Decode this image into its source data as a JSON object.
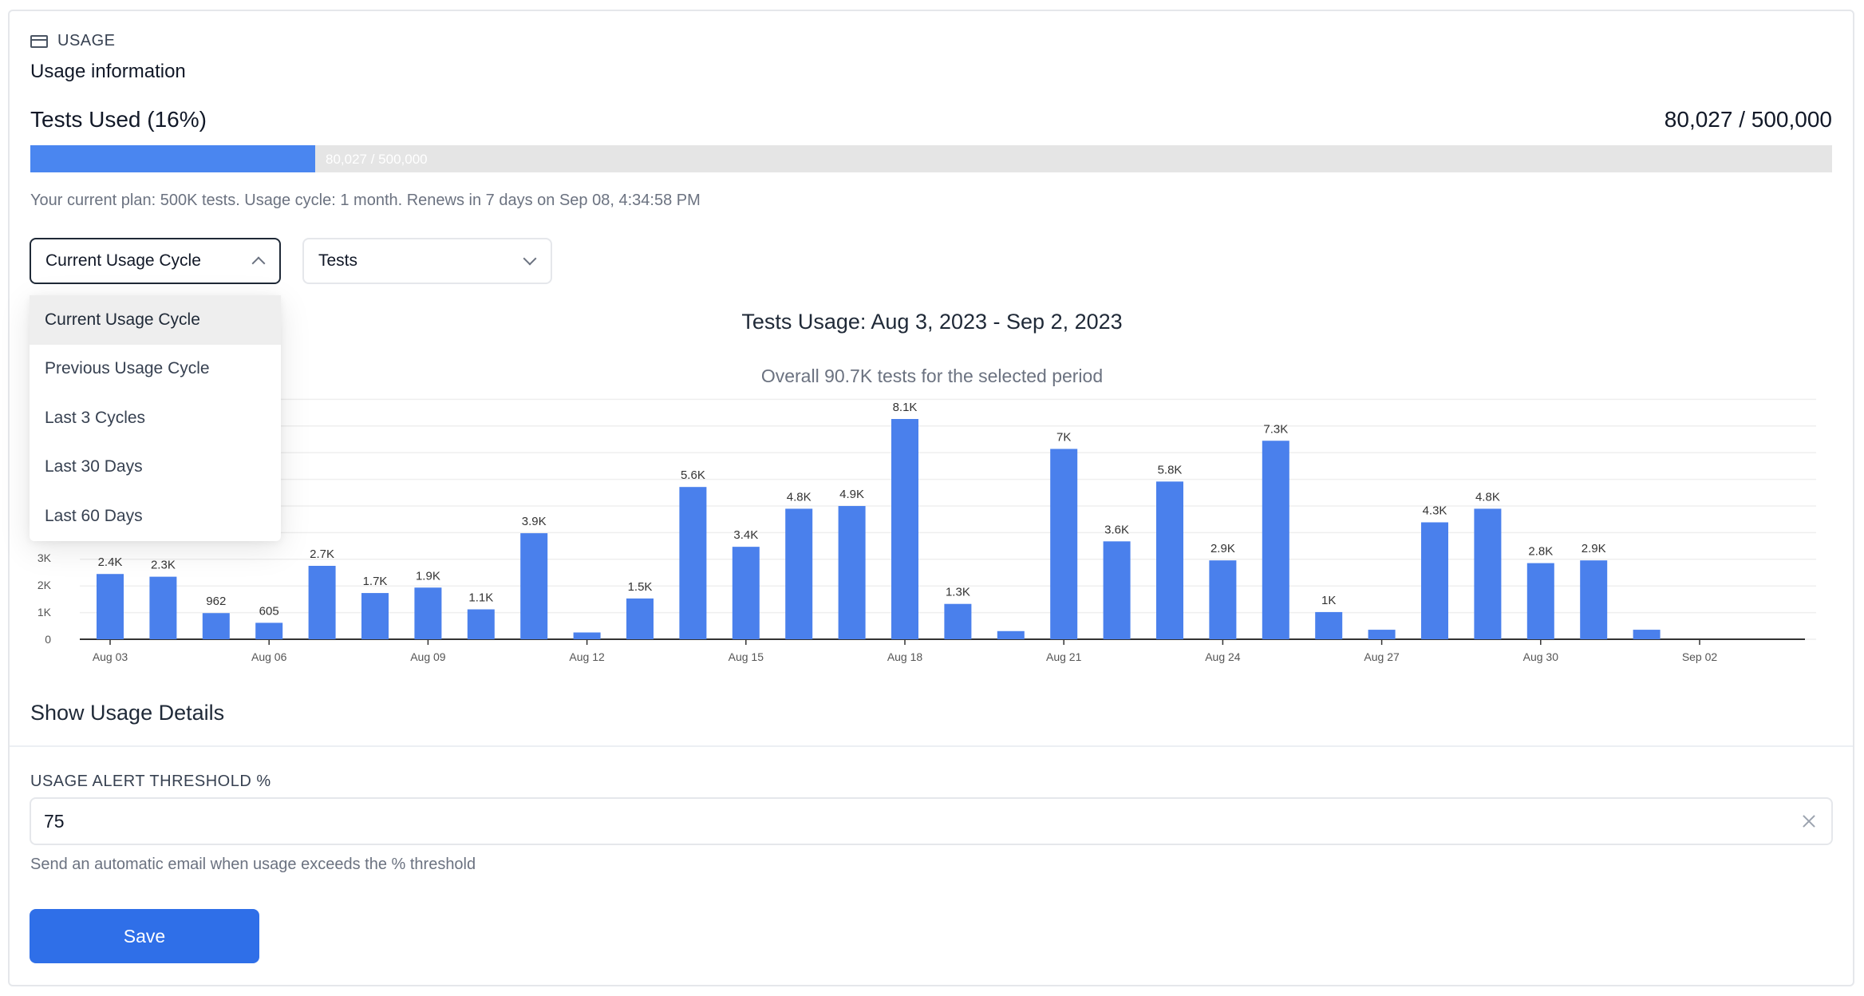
{
  "section": {
    "label": "USAGE",
    "title": "Usage information"
  },
  "usage": {
    "title": "Tests Used (16%)",
    "count": "80,027 / 500,000",
    "progress_fraction": 0.16,
    "progress_text": "80,027 / 500,000",
    "plan_text": "Your current plan: 500K tests. Usage cycle: 1 month. Renews in 7 days on Sep 08, 4:34:58 PM"
  },
  "filters": {
    "period_value": "Current Usage Cycle",
    "metric_value": "Tests",
    "period_options": [
      "Current Usage Cycle",
      "Previous Usage Cycle",
      "Last 3 Cycles",
      "Last 30 Days",
      "Last 60 Days"
    ]
  },
  "chart": {
    "title": "Tests Usage: Aug 3, 2023 - Sep 2, 2023",
    "subtitle": "Overall 90.7K tests for the selected period"
  },
  "chart_data": {
    "type": "bar",
    "title": "Tests Usage: Aug 3, 2023 - Sep 2, 2023",
    "subtitle": "Overall 90.7K tests for the selected period",
    "categories": [
      "Aug 03",
      "Aug 04",
      "Aug 05",
      "Aug 06",
      "Aug 07",
      "Aug 08",
      "Aug 09",
      "Aug 10",
      "Aug 11",
      "Aug 12",
      "Aug 13",
      "Aug 14",
      "Aug 15",
      "Aug 16",
      "Aug 17",
      "Aug 18",
      "Aug 19",
      "Aug 20",
      "Aug 21",
      "Aug 22",
      "Aug 23",
      "Aug 24",
      "Aug 25",
      "Aug 26",
      "Aug 27",
      "Aug 28",
      "Aug 29",
      "Aug 30",
      "Aug 31",
      "Sep 01",
      "Sep 02"
    ],
    "values": [
      2400,
      2300,
      962,
      605,
      2700,
      1700,
      1900,
      1100,
      3900,
      250,
      1500,
      5600,
      3400,
      4800,
      4900,
      8100,
      1300,
      300,
      7000,
      3600,
      5800,
      2900,
      7300,
      1000,
      350,
      4300,
      4800,
      2800,
      2900,
      350,
      0
    ],
    "data_labels": [
      "2.4K",
      "2.3K",
      "962",
      "605",
      "2.7K",
      "1.7K",
      "1.9K",
      "1.1K",
      "3.9K",
      "",
      "1.5K",
      "5.6K",
      "3.4K",
      "4.8K",
      "4.9K",
      "8.1K",
      "1.3K",
      "",
      "7K",
      "3.6K",
      "5.8K",
      "2.9K",
      "7.3K",
      "1K",
      "",
      "4.3K",
      "4.8K",
      "2.8K",
      "2.9K",
      "",
      ""
    ],
    "x_tick_labels": [
      "Aug 03",
      "Aug 06",
      "Aug 09",
      "Aug 12",
      "Aug 15",
      "Aug 18",
      "Aug 21",
      "Aug 24",
      "Aug 27",
      "Aug 30",
      "Sep 02"
    ],
    "y_tick_labels": [
      "0",
      "1K",
      "2K",
      "3K"
    ],
    "ylim": [
      0,
      8100
    ],
    "grid": true,
    "color": "#4a80ec"
  },
  "details": {
    "label": "Show Usage Details"
  },
  "threshold": {
    "label": "USAGE ALERT THRESHOLD %",
    "value": "75",
    "help": "Send an automatic email when usage exceeds the % threshold"
  },
  "actions": {
    "save_label": "Save"
  },
  "icons": {
    "usage": "card-icon",
    "clear": "close-icon"
  }
}
